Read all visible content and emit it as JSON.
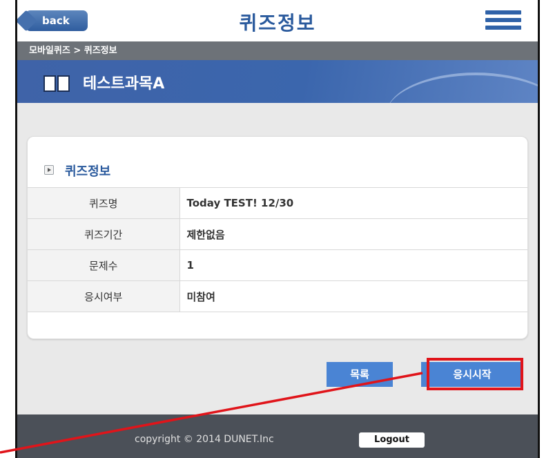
{
  "header": {
    "back_label": "back",
    "title": "퀴즈정보"
  },
  "breadcrumb": "모바일퀴즈 > 퀴즈정보",
  "banner": {
    "subject": "테스트과목A"
  },
  "section": {
    "title": "퀴즈정보"
  },
  "quiz_info": {
    "rows": [
      {
        "label": "퀴즈명",
        "value": "Today TEST! 12/30"
      },
      {
        "label": "퀴즈기간",
        "value": "제한없음"
      },
      {
        "label": "문제수",
        "value": "1"
      },
      {
        "label": "응시여부",
        "value": "미참여"
      }
    ]
  },
  "actions": {
    "list_label": "목록",
    "start_label": "응시시작"
  },
  "footer": {
    "copyright": "copyright © 2014 DUNET.Inc",
    "logout_label": "Logout"
  },
  "colors": {
    "accent": "#2a5a9d",
    "button": "#4a84d4",
    "highlight": "#e0141a",
    "footer": "#4b5058"
  }
}
